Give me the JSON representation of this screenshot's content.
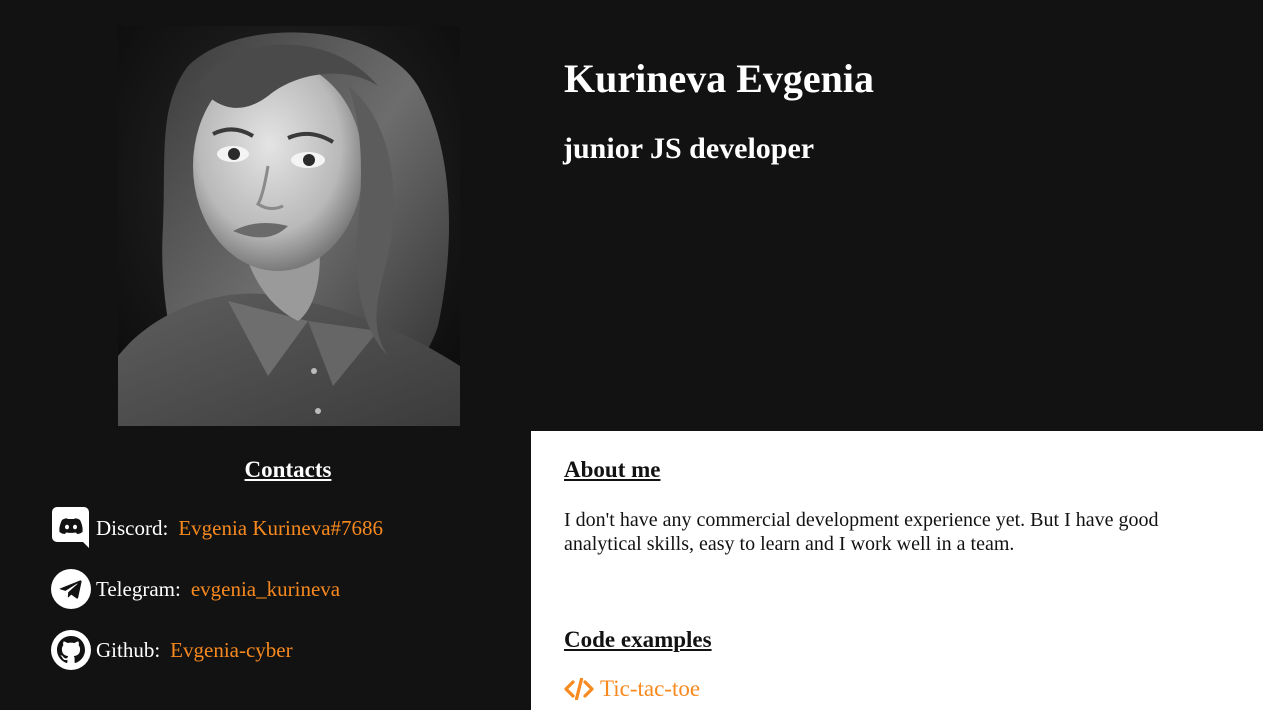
{
  "profile": {
    "name": "Kurineva Evgenia",
    "role": "junior JS developer",
    "photo_icon": "portrait-photo"
  },
  "contacts": {
    "title": "Contacts",
    "items": [
      {
        "icon": "discord-icon",
        "label": "Discord:",
        "value": "Evgenia Kurineva#7686"
      },
      {
        "icon": "telegram-icon",
        "label": "Telegram:",
        "value": "evgenia_kurineva"
      },
      {
        "icon": "github-icon",
        "label": "Github:",
        "value": "Evgenia-cyber"
      }
    ]
  },
  "about": {
    "title": "About me",
    "text": "I don't have any commercial development experience yet. But I have good analytical skills, easy to learn and I work well in a team."
  },
  "code_examples": {
    "title": "Code examples",
    "items": [
      {
        "icon": "code-icon",
        "label": "Tic-tac-toe"
      }
    ]
  },
  "colors": {
    "background": "#121212",
    "panel": "#ffffff",
    "accent": "#f7891f",
    "text_light": "#ffffff",
    "text_dark": "#121212"
  }
}
